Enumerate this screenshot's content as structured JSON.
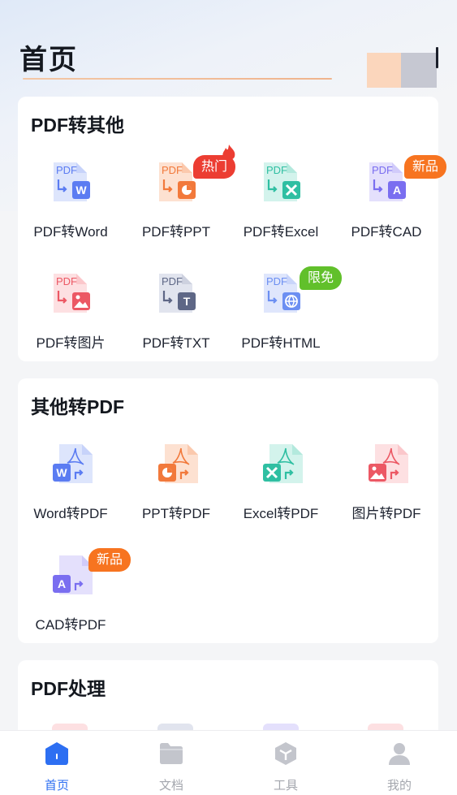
{
  "header": {
    "title": "首页"
  },
  "sections": [
    {
      "title": "PDF转其他",
      "tools": [
        {
          "label": "PDF转Word",
          "icon": "pdf-to-word-icon",
          "badge": ""
        },
        {
          "label": "PDF转PPT",
          "icon": "pdf-to-ppt-icon",
          "badge": "热门"
        },
        {
          "label": "PDF转Excel",
          "icon": "pdf-to-excel-icon",
          "badge": ""
        },
        {
          "label": "PDF转CAD",
          "icon": "pdf-to-cad-icon",
          "badge": "新品"
        },
        {
          "label": "PDF转图片",
          "icon": "pdf-to-image-icon",
          "badge": ""
        },
        {
          "label": "PDF转TXT",
          "icon": "pdf-to-txt-icon",
          "badge": ""
        },
        {
          "label": "PDF转HTML",
          "icon": "pdf-to-html-icon",
          "badge": "限免"
        }
      ]
    },
    {
      "title": "其他转PDF",
      "tools": [
        {
          "label": "Word转PDF",
          "icon": "word-to-pdf-icon",
          "badge": ""
        },
        {
          "label": "PPT转PDF",
          "icon": "ppt-to-pdf-icon",
          "badge": ""
        },
        {
          "label": "Excel转PDF",
          "icon": "excel-to-pdf-icon",
          "badge": ""
        },
        {
          "label": "图片转PDF",
          "icon": "image-to-pdf-icon",
          "badge": ""
        },
        {
          "label": "CAD转PDF",
          "icon": "cad-to-pdf-icon",
          "badge": "新品"
        }
      ]
    },
    {
      "title": "PDF处理",
      "tools": []
    }
  ],
  "icon_text": {
    "pdf": "PDF",
    "word": "W",
    "txt": "T",
    "cad": "A"
  },
  "nav": [
    {
      "label": "首页",
      "icon": "home-icon",
      "active": true
    },
    {
      "label": "文档",
      "icon": "folder-icon",
      "active": false
    },
    {
      "label": "工具",
      "icon": "toolbox-icon",
      "active": false
    },
    {
      "label": "我的",
      "icon": "user-icon",
      "active": false
    }
  ],
  "colors": {
    "word": "#5b7cf2",
    "ppt": "#f2793b",
    "excel": "#2fbfa2",
    "cad": "#7a6ef0",
    "image": "#ec5864",
    "txt": "#5e6786",
    "html": "#6c8ff2",
    "active": "#2d6ff2",
    "hot": "#ec3d32",
    "new": "#f77420",
    "free": "#61c02b"
  }
}
